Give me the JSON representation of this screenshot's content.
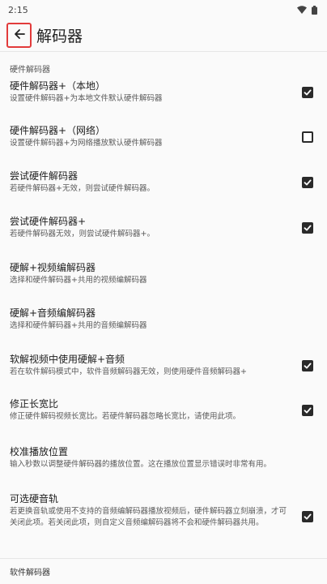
{
  "status": {
    "time": "2:15"
  },
  "header": {
    "title": "解码器"
  },
  "section_hw": "硬件解码器",
  "prefs": [
    {
      "title": "硬件解码器+（本地）",
      "summary": "设置硬件解码器+为本地文件默认硬件解码器",
      "checkbox": "checked"
    },
    {
      "title": "硬件解码器+（网络）",
      "summary": "设置硬件解码器+为网络播放默认硬件解码器",
      "checkbox": "unchecked"
    },
    {
      "title": "尝试硬件解码器",
      "summary": "若硬件解码器+无效，则尝试硬件解码器。",
      "checkbox": "checked"
    },
    {
      "title": "尝试硬件解码器+",
      "summary": "若硬件解码器无效，则尝试硬件解码器+。",
      "checkbox": "checked"
    },
    {
      "title": "硬解+视频编解码器",
      "summary": "选择和硬件解码器+共用的视频编解码器",
      "checkbox": "none"
    },
    {
      "title": "硬解+音频编解码器",
      "summary": "选择和硬件解码器+共用的音频编解码器",
      "checkbox": "none"
    },
    {
      "title": "软解视频中使用硬解+音频",
      "summary": "若在软件解码模式中，软件音频解码器无效，则使用硬件音频解码器+",
      "checkbox": "checked"
    },
    {
      "title": "修正长宽比",
      "summary": "修正硬件解码视频长宽比。若硬件解码器忽略长宽比，请使用此项。",
      "checkbox": "checked"
    },
    {
      "title": "校准播放位置",
      "summary": "输入秒数以调整硬件解码器的播放位置。这在播放位置显示错误时非常有用。",
      "checkbox": "none"
    },
    {
      "title": "可选硬音轨",
      "summary": "若更换音轨或使用不支持的音频编解码器播放视频后，硬件解码器立刻崩溃，才可关闭此项。若关闭此项，则自定义音频编解码器将不会和硬件解码器共用。",
      "checkbox": "checked"
    }
  ],
  "section_sw": "软件解码器"
}
